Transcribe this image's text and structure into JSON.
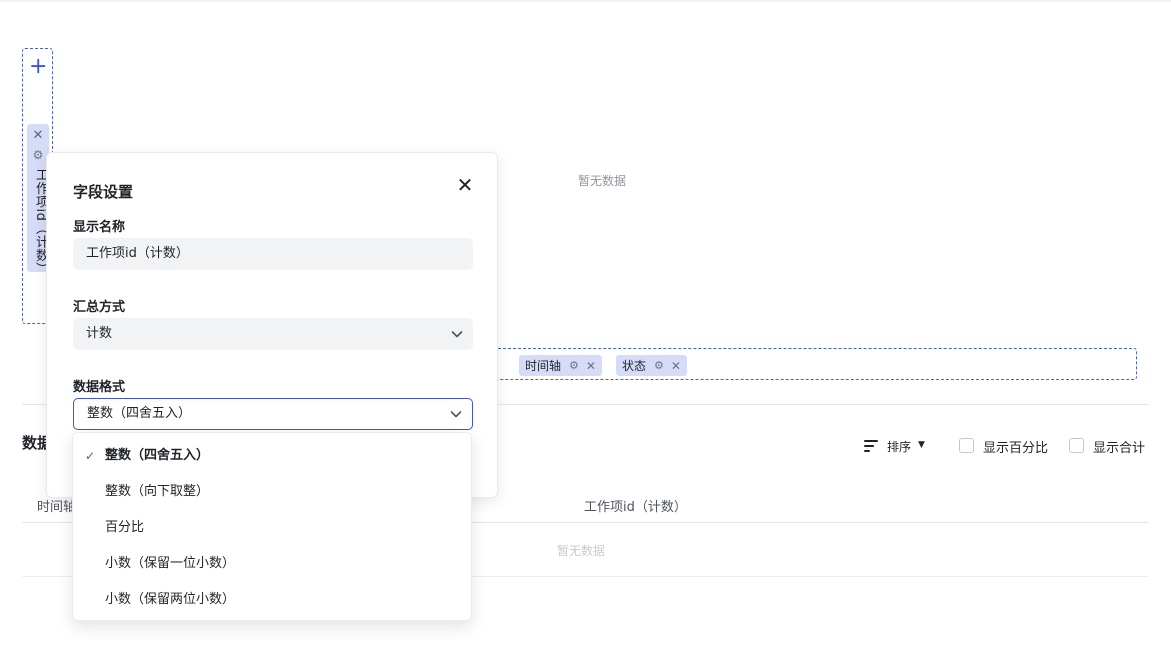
{
  "y_zone": {
    "add_symbol": "+",
    "field_chip_label": "工作项id（计数）"
  },
  "chart_area": {
    "empty_text": "暂无数据"
  },
  "x_zone": {
    "chips": [
      {
        "label": "时间轴"
      },
      {
        "label": "状态"
      }
    ]
  },
  "data_section": {
    "title": "数据",
    "sort_label": "排序",
    "show_percent_label": "显示百分比",
    "show_total_label": "显示合计",
    "columns": [
      "时间轴",
      "工作项id（计数）"
    ],
    "empty_text": "暂无数据"
  },
  "field_settings": {
    "title": "字段设置",
    "display_name_label": "显示名称",
    "display_name_value": "工作项id（计数）",
    "aggregation_label": "汇总方式",
    "aggregation_value": "计数",
    "format_label": "数据格式",
    "format_value": "整数（四舍五入）",
    "format_options": [
      "整数（四舍五入）",
      "整数（向下取整）",
      "百分比",
      "小数（保留一位小数）",
      "小数（保留两位小数）"
    ],
    "selected_option_index": 0
  },
  "icons": {
    "close": "close-icon",
    "gear": "gear-icon",
    "chevron": "chevron-down-icon",
    "check": "check-icon",
    "sort": "sort-icon"
  },
  "colors": {
    "accent": "#3b55d6",
    "chip_bg": "#d6dcf7",
    "panel_bg": "#ffffff",
    "input_bg": "#f2f3f5"
  }
}
